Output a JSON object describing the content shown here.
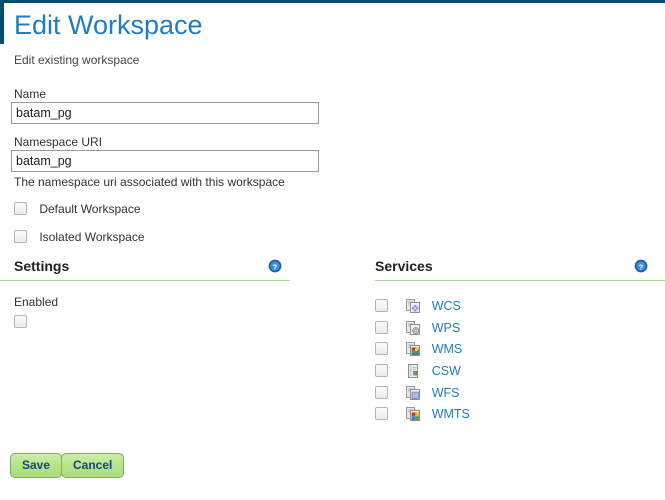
{
  "theme": {
    "accent_blue": "#1f7cbf",
    "rule_navy": "#00506b",
    "section_underline_green": "#a8d98a",
    "button_green": "#b7e48b",
    "button_text_blue": "#19457c"
  },
  "header": {
    "title": "Edit Workspace",
    "subtitle": "Edit existing workspace"
  },
  "form": {
    "name": {
      "label": "Name",
      "value": "batam_pg",
      "placeholder": ""
    },
    "namespace_uri": {
      "label": "Namespace URI",
      "value": "batam_pg",
      "placeholder": "",
      "hint": "The namespace uri associated with this workspace"
    },
    "checkboxes": [
      {
        "label": "Default Workspace",
        "checked": false
      },
      {
        "label": "Isolated Workspace",
        "checked": false
      }
    ]
  },
  "settings": {
    "title": "Settings",
    "help_icon": "help-circle-icon",
    "enabled_label": "Enabled",
    "enabled_checked": false
  },
  "services": {
    "title": "Services",
    "help_icon": "help-circle-icon",
    "items": [
      {
        "name": "WCS",
        "checked": false,
        "icon": "wcs-icon"
      },
      {
        "name": "WPS",
        "checked": false,
        "icon": "wps-icon"
      },
      {
        "name": "WMS",
        "checked": false,
        "icon": "wms-icon"
      },
      {
        "name": "CSW",
        "checked": false,
        "icon": "csw-icon"
      },
      {
        "name": "WFS",
        "checked": false,
        "icon": "wfs-icon"
      },
      {
        "name": "WMTS",
        "checked": false,
        "icon": "wmts-icon"
      }
    ]
  },
  "actions": {
    "save_label": "Save",
    "cancel_label": "Cancel"
  }
}
